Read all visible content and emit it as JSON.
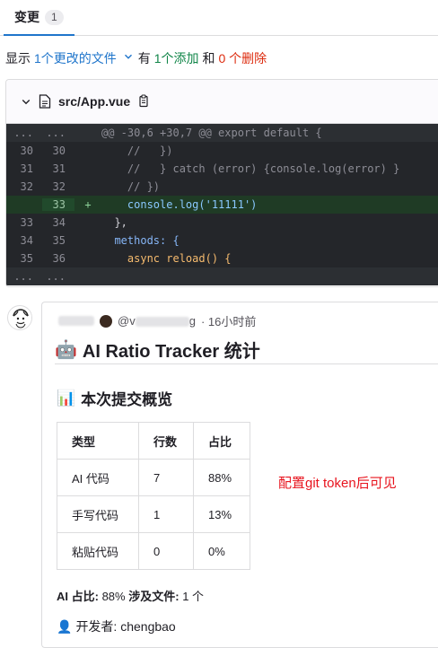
{
  "tabs": [
    {
      "label": "变更",
      "count": "1"
    }
  ],
  "summary": {
    "prefix": "显示",
    "files_changed": "1个更改的文件",
    "has": "有",
    "additions": "1个添加",
    "and": "和",
    "deletions": "0 个删除"
  },
  "file": {
    "name": "src/App.vue",
    "diff": {
      "hunk": "@@ -30,6 +30,7 @@ export default {",
      "ellipsis": "...",
      "lines": [
        {
          "old": "30",
          "new": "30",
          "marker": "",
          "code": "    //   })"
        },
        {
          "old": "31",
          "new": "31",
          "marker": "",
          "code": "    //   } catch (error) {console.log(error) }"
        },
        {
          "old": "32",
          "new": "32",
          "marker": "",
          "code": "    // })"
        },
        {
          "old": "",
          "new": "33",
          "marker": "+",
          "code": "    console.log('11111')"
        },
        {
          "old": "33",
          "new": "34",
          "marker": "",
          "code": "  },"
        },
        {
          "old": "34",
          "new": "35",
          "marker": "",
          "code": "  methods: {"
        },
        {
          "old": "35",
          "new": "36",
          "marker": "",
          "code": "    async reload() {"
        }
      ]
    }
  },
  "comment": {
    "author_handle": "@v",
    "author_handle_end": "g",
    "time": "· 16小时前",
    "title": "AI Ratio Tracker 统计",
    "title_emoji": "🤖",
    "section": "本次提交概览",
    "section_emoji": "📊",
    "table": {
      "headers": [
        "类型",
        "行数",
        "占比"
      ],
      "rows": [
        [
          "AI 代码",
          "7",
          "88%"
        ],
        [
          "手写代码",
          "1",
          "13%"
        ],
        [
          "粘贴代码",
          "0",
          "0%"
        ]
      ]
    },
    "ai_ratio_label": "AI 占比:",
    "ai_ratio_value": "88%",
    "files_label": "涉及文件:",
    "files_value": "1 个",
    "developer_emoji": "👤",
    "developer": "开发者: chengbao"
  },
  "annotation": "配置git token后可见",
  "colors": {
    "accent": "#1f75cb",
    "added": "#108548",
    "deleted": "#dd2b0e",
    "annotation": "#e8141e"
  }
}
